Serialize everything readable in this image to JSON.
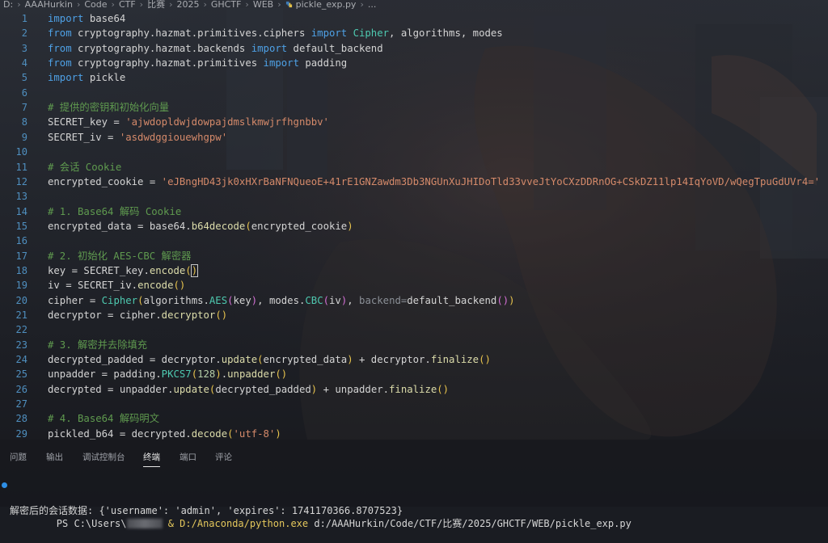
{
  "breadcrumb": {
    "items": [
      "D:",
      "AAAHurkin",
      "Code",
      "CTF",
      "比赛",
      "2025",
      "GHCTF",
      "WEB"
    ],
    "file": "pickle_exp.py",
    "more": "..."
  },
  "editor": {
    "lines": [
      {
        "n": "1",
        "tokens": [
          [
            "kw",
            "import"
          ],
          [
            "mod",
            " base64"
          ]
        ]
      },
      {
        "n": "2",
        "tokens": [
          [
            "kw",
            "from"
          ],
          [
            "mod",
            " cryptography.hazmat.primitives.ciphers "
          ],
          [
            "kw",
            "import"
          ],
          [
            "cls",
            " Cipher"
          ],
          [
            "mod",
            ", algorithms, modes"
          ]
        ]
      },
      {
        "n": "3",
        "tokens": [
          [
            "kw",
            "from"
          ],
          [
            "mod",
            " cryptography.hazmat.backends "
          ],
          [
            "kw",
            "import"
          ],
          [
            "mod",
            " default_backend"
          ]
        ]
      },
      {
        "n": "4",
        "tokens": [
          [
            "kw",
            "from"
          ],
          [
            "mod",
            " cryptography.hazmat.primitives "
          ],
          [
            "kw",
            "import"
          ],
          [
            "mod",
            " padding"
          ]
        ]
      },
      {
        "n": "5",
        "tokens": [
          [
            "kw",
            "import"
          ],
          [
            "mod",
            " pickle"
          ]
        ]
      },
      {
        "n": "6",
        "tokens": []
      },
      {
        "n": "7",
        "tokens": [
          [
            "cm",
            "# 提供的密钥和初始化向量"
          ]
        ]
      },
      {
        "n": "8",
        "tokens": [
          [
            "var",
            "SECRET_key = "
          ],
          [
            "str",
            "'ajwdopldwjdowpajdmslkmwjrfhgnbbv'"
          ]
        ]
      },
      {
        "n": "9",
        "tokens": [
          [
            "var",
            "SECRET_iv = "
          ],
          [
            "str",
            "'asdwdggiouewhgpw'"
          ]
        ]
      },
      {
        "n": "10",
        "tokens": []
      },
      {
        "n": "11",
        "tokens": [
          [
            "cm",
            "# 会话 Cookie"
          ]
        ]
      },
      {
        "n": "12",
        "tokens": [
          [
            "var",
            "encrypted_cookie = "
          ],
          [
            "str",
            "'eJBngHD43jk0xHXrBaNFNQueoE+41rE1GNZawdm3Db3NGUnXuJHIDoTld33vveJtYoCXzDDRnOG+CSkDZ11lp14IqYoVD/wQegTpuGdUVr4='"
          ]
        ]
      },
      {
        "n": "13",
        "tokens": []
      },
      {
        "n": "14",
        "tokens": [
          [
            "cm",
            "# 1. Base64 解码 Cookie"
          ]
        ]
      },
      {
        "n": "15",
        "tokens": [
          [
            "var",
            "encrypted_data = base64."
          ],
          [
            "fn",
            "b64decode"
          ],
          [
            "par",
            "("
          ],
          [
            "var",
            "encrypted_cookie"
          ],
          [
            "par",
            ")"
          ]
        ]
      },
      {
        "n": "16",
        "tokens": []
      },
      {
        "n": "17",
        "tokens": [
          [
            "cm",
            "# 2. 初始化 AES-CBC 解密器"
          ]
        ]
      },
      {
        "n": "18",
        "tokens": [
          [
            "var",
            "key = SECRET_key."
          ],
          [
            "fn",
            "encode"
          ],
          [
            "par",
            "("
          ],
          [
            "parbox",
            ")"
          ]
        ]
      },
      {
        "n": "19",
        "tokens": [
          [
            "var",
            "iv = SECRET_iv."
          ],
          [
            "fn",
            "encode"
          ],
          [
            "par",
            "()"
          ]
        ]
      },
      {
        "n": "20",
        "tokens": [
          [
            "var",
            "cipher = "
          ],
          [
            "cls",
            "Cipher"
          ],
          [
            "par",
            "("
          ],
          [
            "var",
            "algorithms."
          ],
          [
            "cls",
            "AES"
          ],
          [
            "par2",
            "("
          ],
          [
            "var",
            "key"
          ],
          [
            "par2",
            ")"
          ],
          [
            "var",
            ", modes."
          ],
          [
            "cls",
            "CBC"
          ],
          [
            "par2",
            "("
          ],
          [
            "var",
            "iv"
          ],
          [
            "par2",
            ")"
          ],
          [
            "var",
            ", "
          ],
          [
            "dim",
            "backend="
          ],
          [
            "var",
            "default_backend"
          ],
          [
            "par2",
            "()"
          ],
          [
            "par",
            ")"
          ]
        ]
      },
      {
        "n": "21",
        "tokens": [
          [
            "var",
            "decryptor = cipher."
          ],
          [
            "fn",
            "decryptor"
          ],
          [
            "par",
            "()"
          ]
        ]
      },
      {
        "n": "22",
        "tokens": []
      },
      {
        "n": "23",
        "tokens": [
          [
            "cm",
            "# 3. 解密并去除填充"
          ]
        ]
      },
      {
        "n": "24",
        "tokens": [
          [
            "var",
            "decrypted_padded = decryptor."
          ],
          [
            "fn",
            "update"
          ],
          [
            "par",
            "("
          ],
          [
            "var",
            "encrypted_data"
          ],
          [
            "par",
            ")"
          ],
          [
            "var",
            " + decryptor."
          ],
          [
            "fn",
            "finalize"
          ],
          [
            "par",
            "()"
          ]
        ]
      },
      {
        "n": "25",
        "tokens": [
          [
            "var",
            "unpadder = padding."
          ],
          [
            "cls",
            "PKCS7"
          ],
          [
            "par",
            "("
          ],
          [
            "num",
            "128"
          ],
          [
            "par",
            ")"
          ],
          [
            "var",
            "."
          ],
          [
            "fn",
            "unpadder"
          ],
          [
            "par",
            "()"
          ]
        ]
      },
      {
        "n": "26",
        "tokens": [
          [
            "var",
            "decrypted = unpadder."
          ],
          [
            "fn",
            "update"
          ],
          [
            "par",
            "("
          ],
          [
            "var",
            "decrypted_padded"
          ],
          [
            "par",
            ")"
          ],
          [
            "var",
            " + unpadder."
          ],
          [
            "fn",
            "finalize"
          ],
          [
            "par",
            "()"
          ]
        ]
      },
      {
        "n": "27",
        "tokens": []
      },
      {
        "n": "28",
        "tokens": [
          [
            "cm",
            "# 4. Base64 解码明文"
          ]
        ]
      },
      {
        "n": "29",
        "tokens": [
          [
            "var",
            "pickled_b64 = decrypted."
          ],
          [
            "fn",
            "decode"
          ],
          [
            "par",
            "("
          ],
          [
            "str",
            "'utf-8'"
          ],
          [
            "par",
            ")"
          ]
        ]
      }
    ]
  },
  "panel": {
    "tabs": [
      {
        "id": "problems",
        "label": "问题"
      },
      {
        "id": "output",
        "label": "输出"
      },
      {
        "id": "debug-console",
        "label": "调试控制台"
      },
      {
        "id": "terminal",
        "label": "终端",
        "active": true
      },
      {
        "id": "ports",
        "label": "端口"
      },
      {
        "id": "comments",
        "label": "评论"
      }
    ]
  },
  "terminal": {
    "prompt": "PS C:\\Users\\",
    "command_exe": "& D:/Anaconda/python.exe",
    "command_args": " d:/AAAHurkin/Code/CTF/比赛/2025/GHCTF/WEB/pickle_exp.py",
    "output": "解密后的会话数据: {'username': 'admin', 'expires': 1741170366.8707523}"
  },
  "colors": {
    "keyword": "#4ea1e6",
    "class": "#4ec9b0",
    "comment": "#5f9a4f",
    "string": "#d58a6a",
    "function": "#dcdcaa",
    "line_number": "#4f8fbf",
    "terminal_dot": "#2e8fe6",
    "exe_path": "#e4c75c"
  }
}
